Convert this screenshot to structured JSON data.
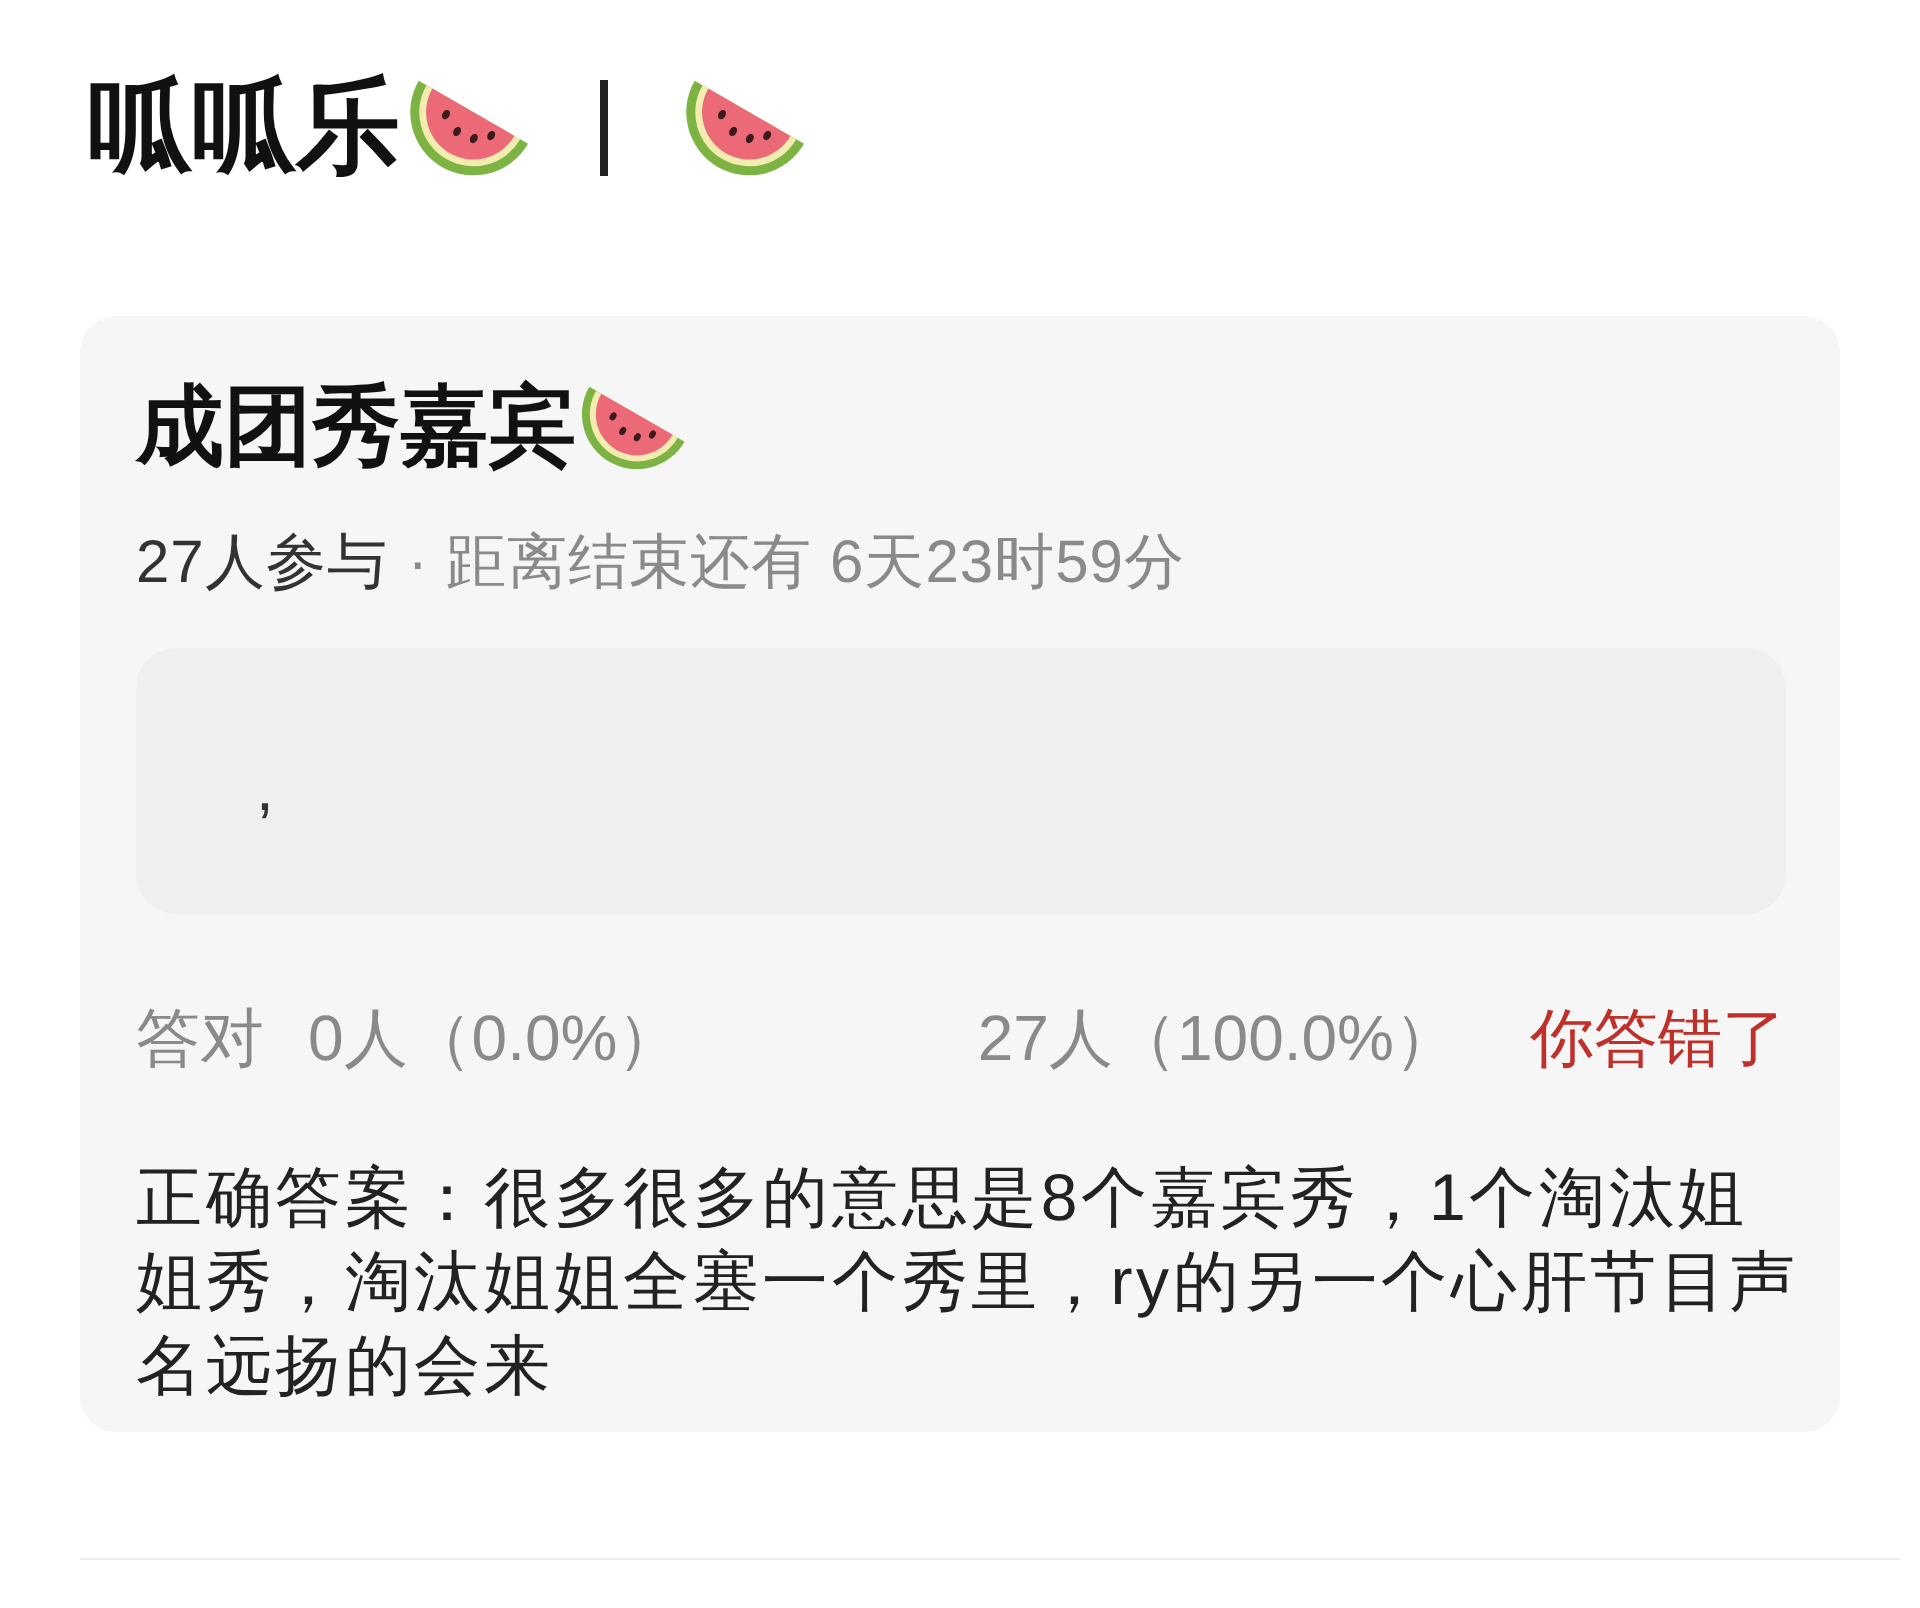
{
  "header": {
    "title": "呱呱乐"
  },
  "quiz": {
    "title": "成团秀嘉宾",
    "participants": "27人参与",
    "countdown": "· 距离结束还有 6天23时59分",
    "options": [
      {
        "text": ","
      }
    ],
    "stats": {
      "correct_label": "答对",
      "correct_count": "0人（0.0%）",
      "wrong_count": "27人（100.0%）",
      "verdict": "你答错了"
    },
    "answer": "正确答案：很多很多的意思是8个嘉宾秀，1个淘汰姐姐秀，淘汰姐姐全塞一个秀里，ry的另一个心肝节目声名远扬的会来"
  }
}
